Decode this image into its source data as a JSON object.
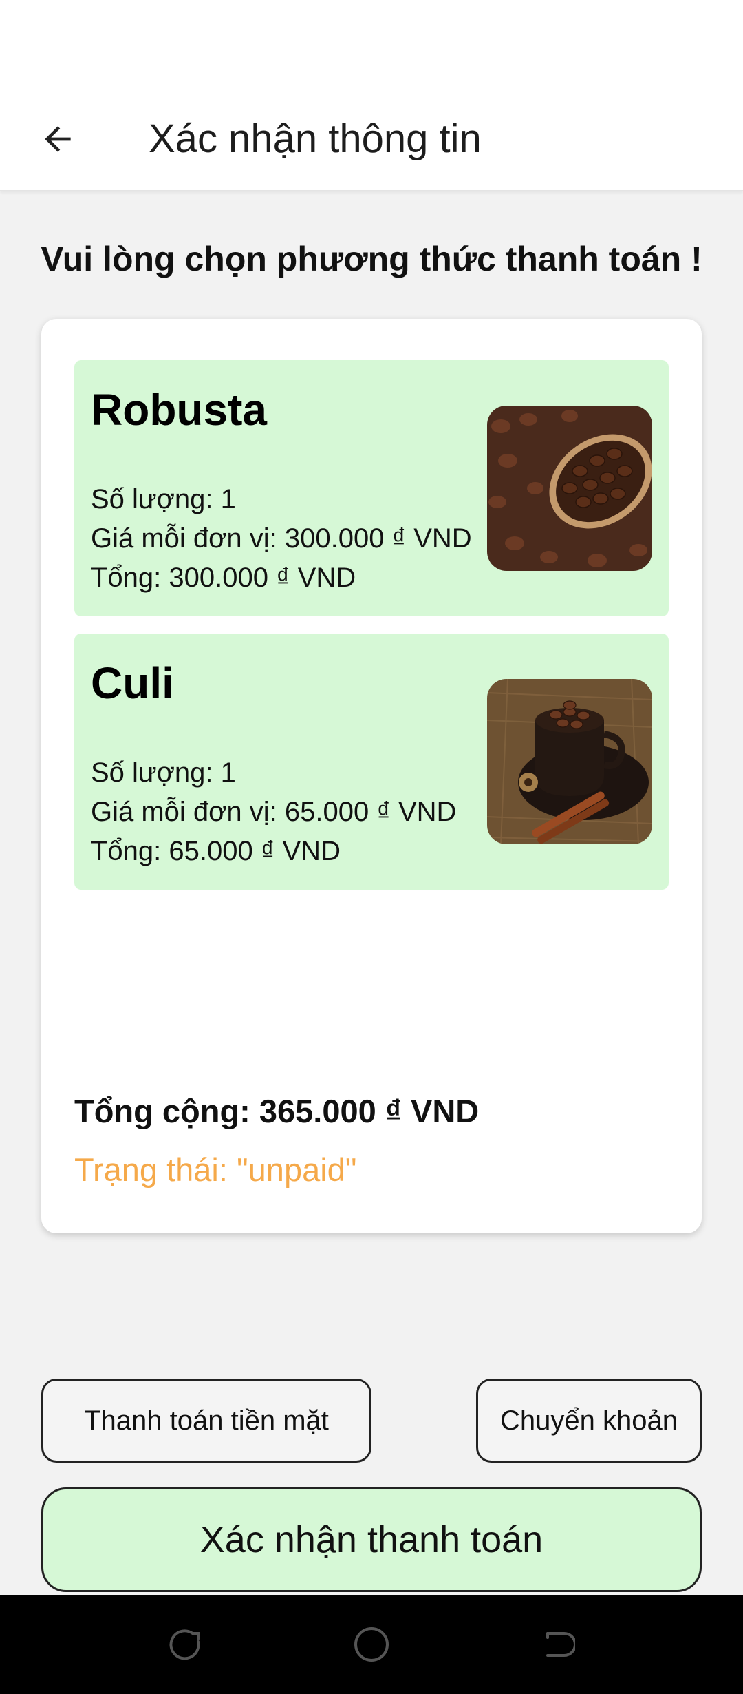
{
  "app_bar": {
    "title": "Xác nhận thông tin",
    "back_icon": "arrow-left-icon"
  },
  "heading": "Vui lòng chọn phương thức thanh toán !",
  "items": [
    {
      "name": "Robusta",
      "quantity_line": "Số lượng: 1",
      "unit_price_line": "Giá mỗi đơn vị: 300.000 ₫ VND",
      "total_line": "Tổng: 300.000 ₫ VND",
      "image": "coffee-beans-scoop"
    },
    {
      "name": "Culi",
      "quantity_line": "Số lượng: 1",
      "unit_price_line": "Giá mỗi đơn vị: 65.000 ₫ VND",
      "total_line": "Tổng: 65.000 ₫ VND",
      "image": "coffee-beans-cup"
    }
  ],
  "summary": {
    "grand_total": "Tổng cộng: 365.000 ₫ VND",
    "status": "Trạng thái: \"unpaid\""
  },
  "payment_methods": {
    "cash": "Thanh toán tiền mặt",
    "transfer": "Chuyển khoản"
  },
  "confirm_button": "Xác nhận thanh toán",
  "nav": {
    "recent": "recent-apps-icon",
    "home": "home-icon",
    "back": "back-icon"
  },
  "colors": {
    "item_bg": "#d6f8d6",
    "status_text": "#f5a94a",
    "confirm_bg": "#d6f8d6",
    "page_bg": "#f2f2f2"
  }
}
